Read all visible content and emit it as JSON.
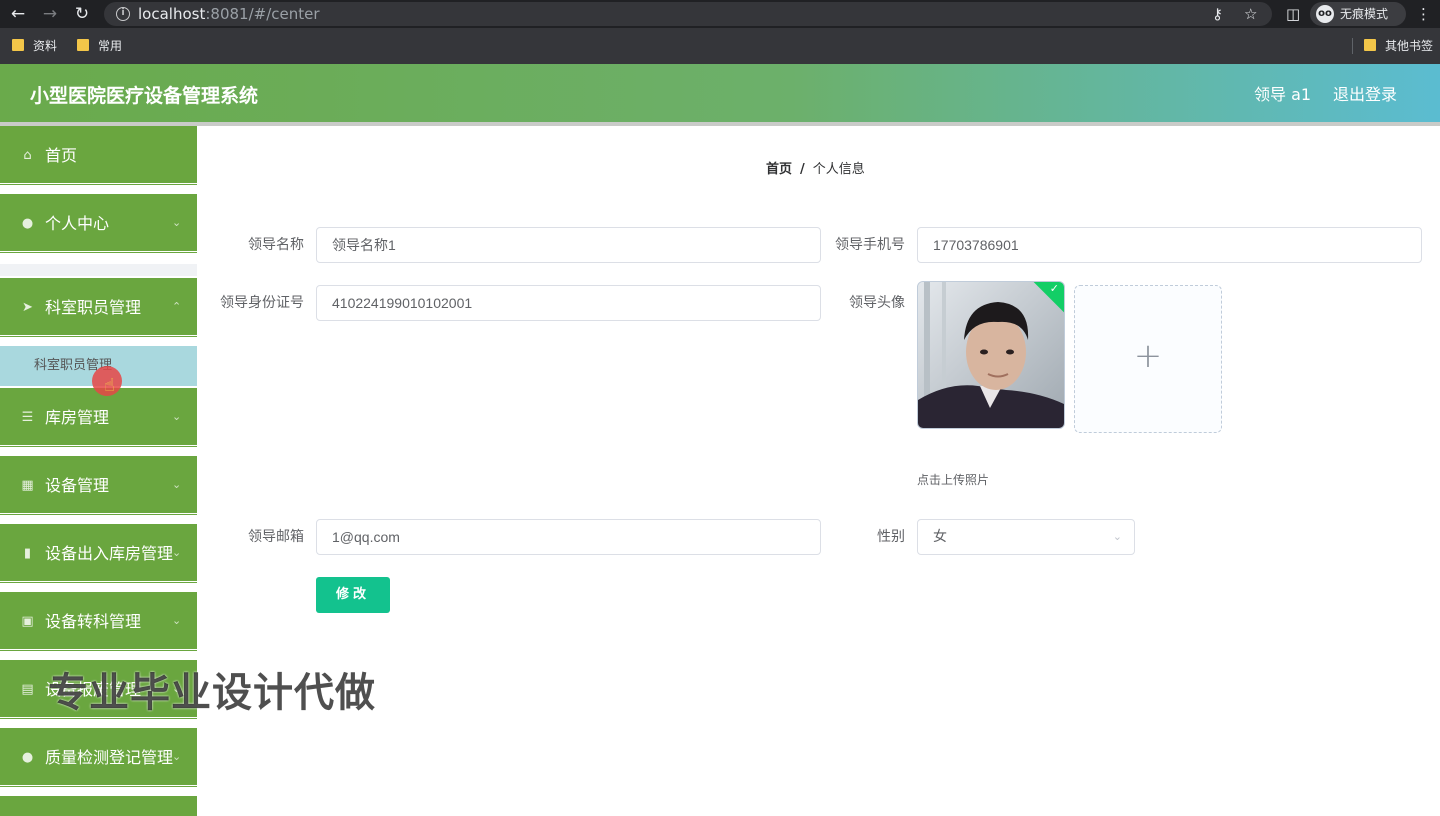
{
  "browser": {
    "url_host": "localhost",
    "url_port": ":8081",
    "url_path": "/#/center",
    "incognito_label": "无痕模式",
    "bookmarks": [
      "资料",
      "常用"
    ],
    "other_bookmarks": "其他书签"
  },
  "header": {
    "title": "小型医院医疗设备管理系统",
    "user_label": "领导 a1",
    "logout_label": "退出登录"
  },
  "sidebar": {
    "items": [
      {
        "label": "首页",
        "icon": "home-icon"
      },
      {
        "label": "个人中心",
        "icon": "user-icon"
      },
      {
        "label": "科室职员管理",
        "icon": "send-icon"
      },
      {
        "label": "库房管理",
        "icon": "menu-lines-icon"
      },
      {
        "label": "设备管理",
        "icon": "grid-icon"
      },
      {
        "label": "设备出入库房管理",
        "icon": "device-icon"
      },
      {
        "label": "设备转科管理",
        "icon": "clipboard-icon"
      },
      {
        "label": "设备报废管理",
        "icon": "document-icon"
      },
      {
        "label": "质量检测登记管理",
        "icon": "user-icon"
      }
    ],
    "submenu_label": "科室职员管理"
  },
  "breadcrumb": {
    "home": "首页",
    "separator": "/",
    "current": "个人信息"
  },
  "form": {
    "name_label": "领导名称",
    "name_value": "领导名称1",
    "phone_label": "领导手机号",
    "phone_value": "17703786901",
    "id_label": "领导身份证号",
    "id_value": "410224199010102001",
    "avatar_label": "领导头像",
    "upload_tip": "点击上传照片",
    "email_label": "领导邮箱",
    "email_value": "1@qq.com",
    "gender_label": "性别",
    "gender_value": "女",
    "submit_label": "修改"
  },
  "watermark": "专业毕业设计代做",
  "colors": {
    "sidebar_green": "#6aa63f",
    "submit_green": "#13c28e",
    "submenu_active": "#a9d8de"
  }
}
